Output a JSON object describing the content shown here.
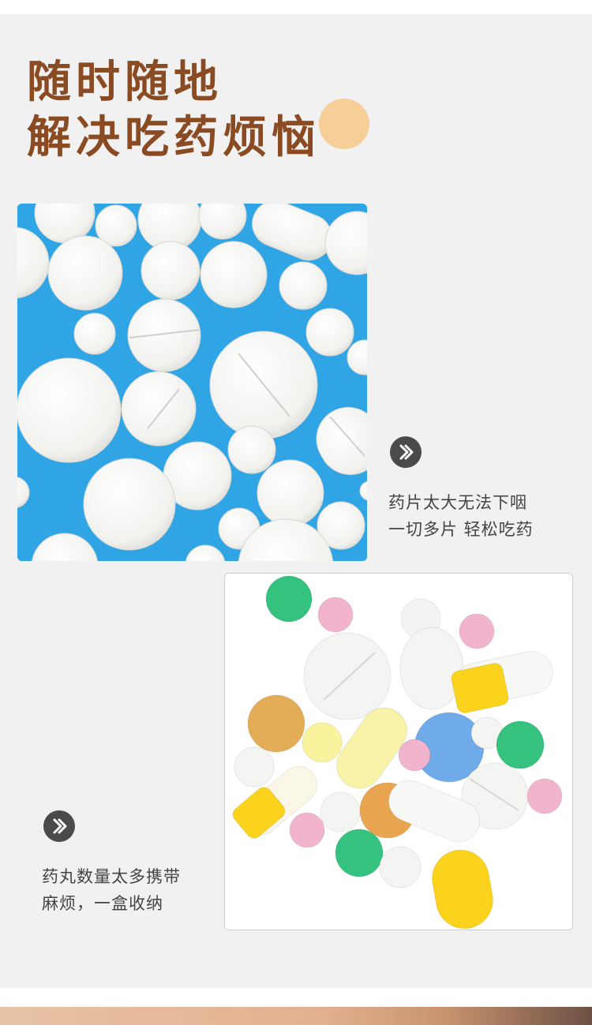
{
  "headline": {
    "line1": "随时随地",
    "line2": "解决吃药烦恼"
  },
  "feature1": {
    "icon": "double-chevron-right-icon",
    "line1": "药片太大无法下咽",
    "line2": "一切多片 轻松吃药"
  },
  "feature2": {
    "icon": "double-chevron-right-icon",
    "line1": "药丸数量太多携带",
    "line2": "麻烦，一盒收纳"
  },
  "colors": {
    "headline": "#8a4a22",
    "panel_background": "#f1f1f1",
    "accent_circle": "#f6c27a",
    "icon_background": "#4a4a4a",
    "pill_photo_background": "#2fa5e6"
  }
}
